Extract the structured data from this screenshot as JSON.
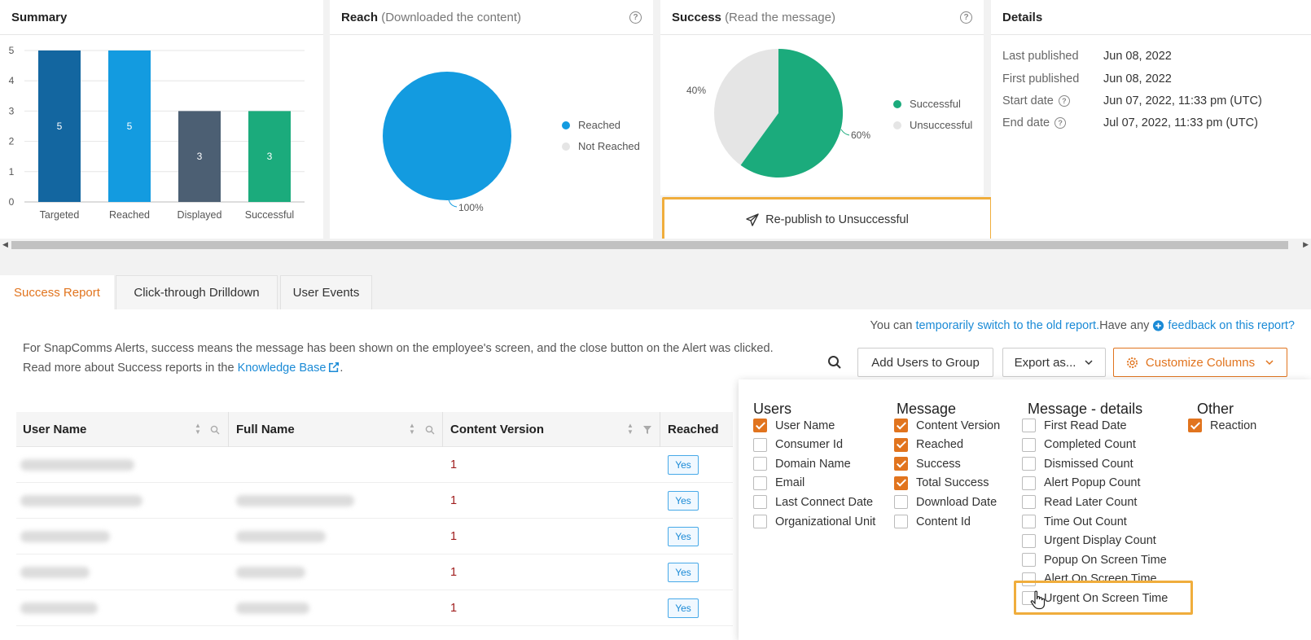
{
  "summary": {
    "title": "Summary",
    "chart_data": {
      "type": "bar",
      "categories": [
        "Targeted",
        "Reached",
        "Displayed",
        "Successful"
      ],
      "values": [
        5,
        5,
        3,
        3
      ],
      "ylim": [
        0,
        5
      ],
      "yticks": [
        "0",
        "1",
        "2",
        "3",
        "4",
        "5"
      ],
      "colors": [
        "#1366a0",
        "#139be0",
        "#4c5f73",
        "#1bab7c"
      ]
    }
  },
  "reach": {
    "title": "Reach",
    "subtitle": "(Downloaded the content)",
    "chart_data": {
      "type": "pie",
      "slices": [
        {
          "name": "Reached",
          "value": 100
        },
        {
          "name": "Not Reached",
          "value": 0
        }
      ],
      "label": "100%",
      "colors": [
        "#139be0",
        "#e5e5e5"
      ]
    },
    "legend": [
      "Reached",
      "Not Reached"
    ]
  },
  "success": {
    "title": "Success",
    "subtitle": "(Read the message)",
    "chart_data": {
      "type": "pie",
      "slices": [
        {
          "name": "Successful",
          "value": 60
        },
        {
          "name": "Unsuccessful",
          "value": 40
        }
      ],
      "labels": [
        "60%",
        "40%"
      ],
      "colors": [
        "#1bab7c",
        "#e5e5e5"
      ]
    },
    "legend": [
      "Successful",
      "Unsuccessful"
    ],
    "republish_label": "Re-publish to Unsuccessful"
  },
  "details": {
    "title": "Details",
    "rows": [
      {
        "key": "Last published",
        "value": "Jun 08, 2022"
      },
      {
        "key": "First published",
        "value": "Jun 08, 2022"
      },
      {
        "key": "Start date",
        "value": "Jun 07, 2022, 11:33 pm (UTC)"
      },
      {
        "key": "End date",
        "value": "Jul 07, 2022, 11:33 pm (UTC)"
      }
    ]
  },
  "tabs": [
    "Success Report",
    "Click-through Drilldown",
    "User Events"
  ],
  "info": {
    "line1": "For SnapComms Alerts, success means the message has been shown on the employee's screen, and the close button on the Alert was clicked.",
    "line2_prefix": "Read more about Success reports in the ",
    "line2_link": "Knowledge Base",
    "line2_suffix": "."
  },
  "topline": {
    "prefix": "You can ",
    "old_report_link": "temporarily switch to the old report.",
    "middle": " Have any ",
    "feedback_link": "feedback on this report?"
  },
  "toolbar": {
    "add_users": "Add Users to Group",
    "export": "Export as...",
    "customize": "Customize Columns"
  },
  "table": {
    "headers": [
      "User Name",
      "Full Name",
      "Content Version",
      "Reached"
    ],
    "rows": [
      {
        "version": "1",
        "reached": "Yes"
      },
      {
        "version": "1",
        "reached": "Yes"
      },
      {
        "version": "1",
        "reached": "Yes"
      },
      {
        "version": "1",
        "reached": "Yes"
      },
      {
        "version": "1",
        "reached": "Yes"
      }
    ]
  },
  "columns": {
    "users": {
      "title": "Users",
      "items": [
        {
          "label": "User Name",
          "checked": true
        },
        {
          "label": "Consumer Id",
          "checked": false
        },
        {
          "label": "Domain Name",
          "checked": false
        },
        {
          "label": "Email",
          "checked": false
        },
        {
          "label": "Last Connect Date",
          "checked": false
        },
        {
          "label": "Organizational Unit",
          "checked": false
        }
      ]
    },
    "message": {
      "title": "Message",
      "items": [
        {
          "label": "Content Version",
          "checked": true
        },
        {
          "label": "Reached",
          "checked": true
        },
        {
          "label": "Success",
          "checked": true
        },
        {
          "label": "Total Success",
          "checked": true
        },
        {
          "label": "Download Date",
          "checked": false
        },
        {
          "label": "Content Id",
          "checked": false
        }
      ]
    },
    "details": {
      "title": "Message - details",
      "items": [
        {
          "label": "First Read Date",
          "checked": false
        },
        {
          "label": "Completed Count",
          "checked": false
        },
        {
          "label": "Dismissed Count",
          "checked": false
        },
        {
          "label": "Alert Popup Count",
          "checked": false
        },
        {
          "label": "Read Later Count",
          "checked": false
        },
        {
          "label": "Time Out Count",
          "checked": false
        },
        {
          "label": "Urgent Display Count",
          "checked": false
        },
        {
          "label": "Popup On Screen Time",
          "checked": false
        },
        {
          "label": "Alert On Screen Time",
          "checked": false
        },
        {
          "label": "Urgent On Screen Time",
          "checked": false
        }
      ]
    },
    "other": {
      "title": "Other",
      "items": [
        {
          "label": "Reaction",
          "checked": true
        }
      ]
    }
  }
}
